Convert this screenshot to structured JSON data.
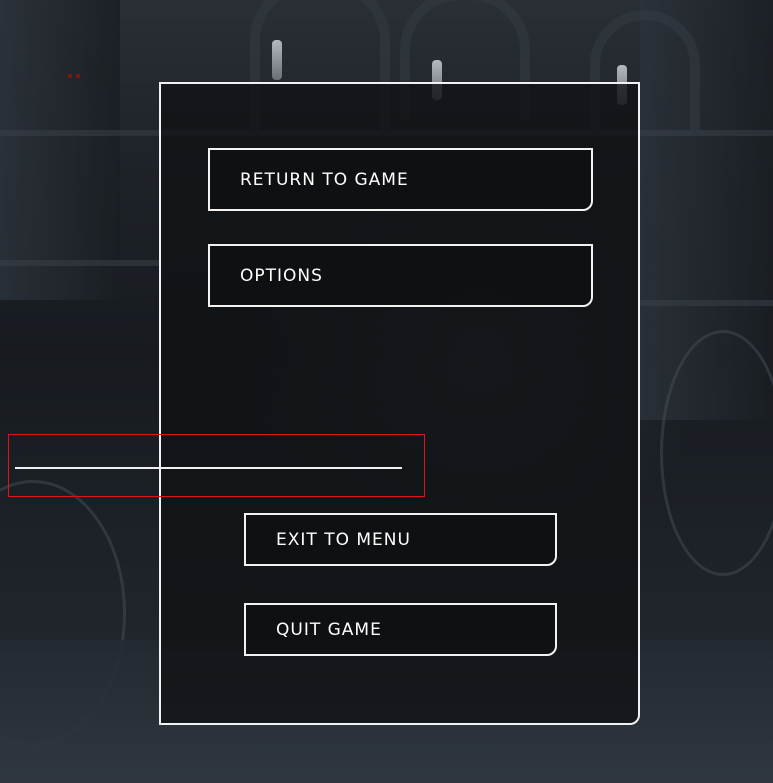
{
  "pause_menu": {
    "buttons": {
      "return_to_game": "RETURN TO GAME",
      "options": "OPTIONS",
      "exit_to_menu": "EXIT TO MENU",
      "quit_game": "QUIT GAME"
    }
  },
  "colors": {
    "panel_border": "#f2f2f2",
    "highlight_border": "#e01414",
    "text": "#ffffff"
  }
}
